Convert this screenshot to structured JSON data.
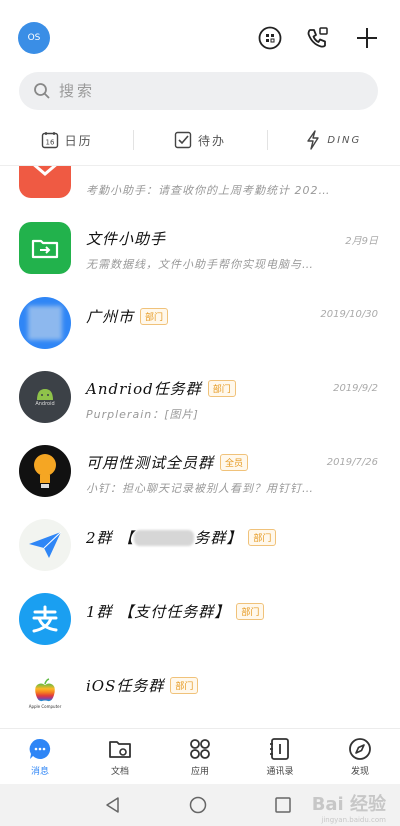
{
  "header": {
    "avatar_text": "OS",
    "icons": [
      "qr-scan-icon",
      "phone-icon",
      "plus-icon"
    ]
  },
  "search": {
    "placeholder": "搜索"
  },
  "quickbar": [
    {
      "label": "日历",
      "icon": "calendar-icon",
      "day": "16"
    },
    {
      "label": "待办",
      "icon": "checkbox-icon"
    },
    {
      "label": "DING",
      "icon": "lightning-icon"
    }
  ],
  "conversations": [
    {
      "name": "",
      "preview": "考勤小助手：请查收你的上周考勤统计 202…",
      "time": "",
      "badge": ""
    },
    {
      "name": "文件小助手",
      "preview": "无需数据线，文件小助手帮你实现电脑与…",
      "time": "2月9日",
      "badge": ""
    },
    {
      "name": "广州市",
      "preview": "",
      "time": "2019/10/30",
      "badge": "部门"
    },
    {
      "name": "Andriod任务群",
      "preview": "Purplerain：[图片]",
      "time": "2019/9/2",
      "badge": "部门",
      "avatar_text": "Android"
    },
    {
      "name": "可用性测试全员群",
      "preview": "小钉：担心聊天记录被别人看到？用钉钉…",
      "time": "2019/7/26",
      "badge": "全员"
    },
    {
      "name_prefix": "2群 【",
      "name_suffix": "务群】",
      "preview": "",
      "time": "",
      "badge": "部门"
    },
    {
      "name": "1群 【支付任务群】",
      "preview": "",
      "time": "",
      "badge": "部门"
    },
    {
      "name": "iOS任务群",
      "preview": "",
      "time": "",
      "badge": "部门",
      "avatar_text": "Apple Computer"
    }
  ],
  "bottom_nav": [
    {
      "label": "消息",
      "icon": "chat-icon",
      "active": true
    },
    {
      "label": "文档",
      "icon": "folder-icon",
      "active": false
    },
    {
      "label": "应用",
      "icon": "apps-icon",
      "active": false
    },
    {
      "label": "通讯录",
      "icon": "contacts-icon",
      "active": false
    },
    {
      "label": "发现",
      "icon": "compass-icon",
      "active": false
    }
  ],
  "watermark": {
    "title": "Bai 经验",
    "sub": "jingyan.baidu.com"
  },
  "colors": {
    "accent": "#2f86f6",
    "badge": "#e69a22"
  }
}
